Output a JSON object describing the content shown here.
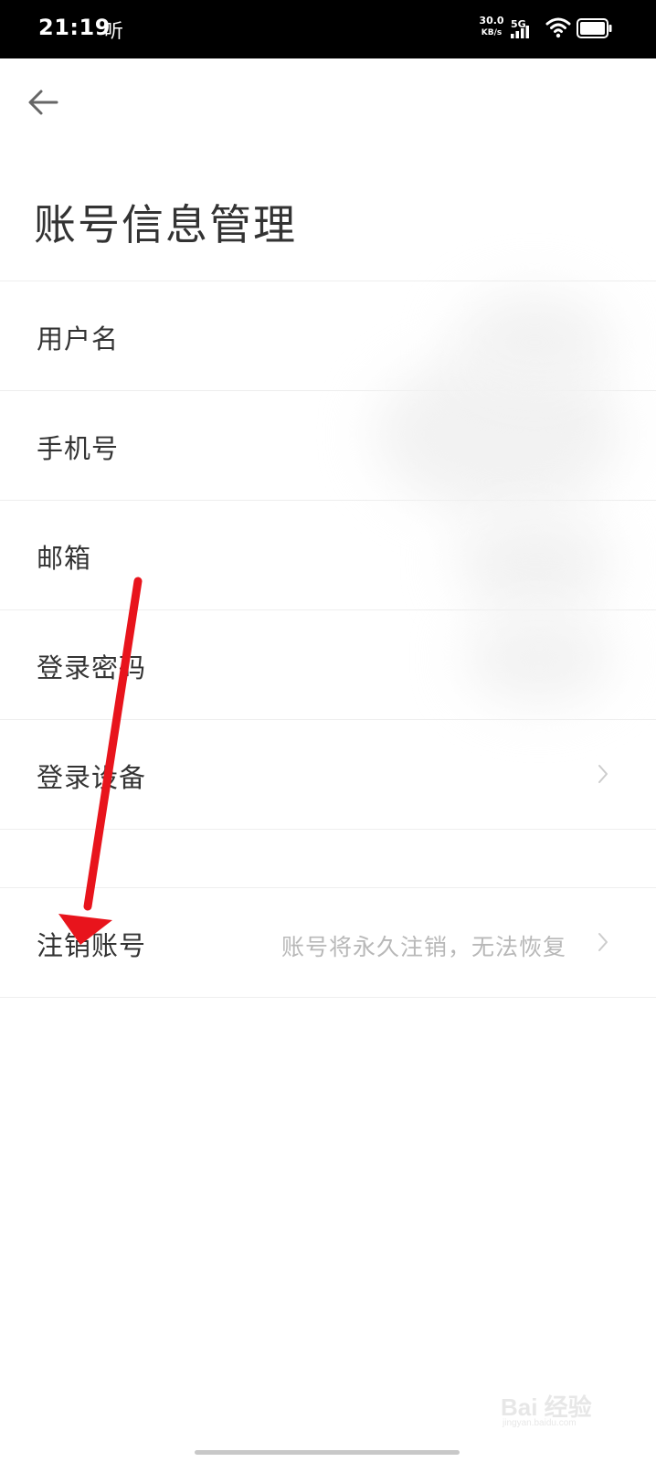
{
  "status_bar": {
    "time": "21:19",
    "listen_indicator": "听",
    "net_speed": "30.0",
    "net_speed_unit": "KB/s",
    "network_type": "5G",
    "icons": [
      "signal-icon",
      "wifi-icon",
      "battery-icon"
    ]
  },
  "header": {
    "back_icon": "arrow-left-icon",
    "title": "账号信息管理"
  },
  "settings": {
    "items": [
      {
        "label": "用户名"
      },
      {
        "label": "手机号"
      },
      {
        "label": "邮箱"
      },
      {
        "label": "登录密码"
      },
      {
        "label": "登录设备",
        "chevron": true
      }
    ],
    "deactivate": {
      "label": "注销账号",
      "hint": "账号将永久注销，无法恢复",
      "chevron": true
    }
  },
  "annotation": {
    "arrow_color": "#e8141c"
  },
  "watermark": {
    "brand": "Bai 经验",
    "domain": "jingyan.baidu.com"
  },
  "colors": {
    "status_bar_bg": "#000000",
    "text_primary": "#333333",
    "text_hint": "#b8b8b8",
    "divider": "#eeeeee"
  }
}
